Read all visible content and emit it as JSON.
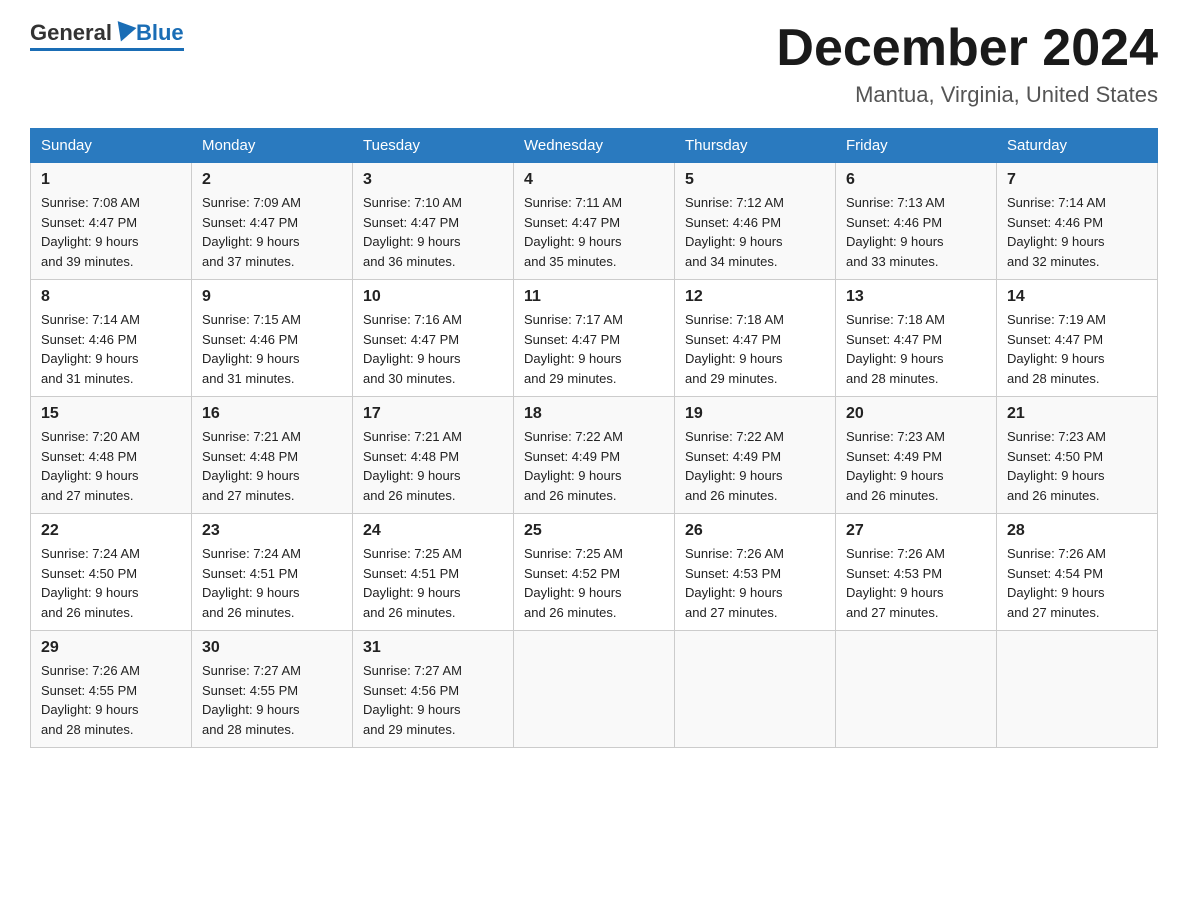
{
  "header": {
    "logo_general": "General",
    "logo_blue": "Blue",
    "month_title": "December 2024",
    "location": "Mantua, Virginia, United States"
  },
  "weekdays": [
    "Sunday",
    "Monday",
    "Tuesday",
    "Wednesday",
    "Thursday",
    "Friday",
    "Saturday"
  ],
  "weeks": [
    [
      {
        "day": "1",
        "sunrise": "7:08 AM",
        "sunset": "4:47 PM",
        "daylight": "9 hours and 39 minutes."
      },
      {
        "day": "2",
        "sunrise": "7:09 AM",
        "sunset": "4:47 PM",
        "daylight": "9 hours and 37 minutes."
      },
      {
        "day": "3",
        "sunrise": "7:10 AM",
        "sunset": "4:47 PM",
        "daylight": "9 hours and 36 minutes."
      },
      {
        "day": "4",
        "sunrise": "7:11 AM",
        "sunset": "4:47 PM",
        "daylight": "9 hours and 35 minutes."
      },
      {
        "day": "5",
        "sunrise": "7:12 AM",
        "sunset": "4:46 PM",
        "daylight": "9 hours and 34 minutes."
      },
      {
        "day": "6",
        "sunrise": "7:13 AM",
        "sunset": "4:46 PM",
        "daylight": "9 hours and 33 minutes."
      },
      {
        "day": "7",
        "sunrise": "7:14 AM",
        "sunset": "4:46 PM",
        "daylight": "9 hours and 32 minutes."
      }
    ],
    [
      {
        "day": "8",
        "sunrise": "7:14 AM",
        "sunset": "4:46 PM",
        "daylight": "9 hours and 31 minutes."
      },
      {
        "day": "9",
        "sunrise": "7:15 AM",
        "sunset": "4:46 PM",
        "daylight": "9 hours and 31 minutes."
      },
      {
        "day": "10",
        "sunrise": "7:16 AM",
        "sunset": "4:47 PM",
        "daylight": "9 hours and 30 minutes."
      },
      {
        "day": "11",
        "sunrise": "7:17 AM",
        "sunset": "4:47 PM",
        "daylight": "9 hours and 29 minutes."
      },
      {
        "day": "12",
        "sunrise": "7:18 AM",
        "sunset": "4:47 PM",
        "daylight": "9 hours and 29 minutes."
      },
      {
        "day": "13",
        "sunrise": "7:18 AM",
        "sunset": "4:47 PM",
        "daylight": "9 hours and 28 minutes."
      },
      {
        "day": "14",
        "sunrise": "7:19 AM",
        "sunset": "4:47 PM",
        "daylight": "9 hours and 28 minutes."
      }
    ],
    [
      {
        "day": "15",
        "sunrise": "7:20 AM",
        "sunset": "4:48 PM",
        "daylight": "9 hours and 27 minutes."
      },
      {
        "day": "16",
        "sunrise": "7:21 AM",
        "sunset": "4:48 PM",
        "daylight": "9 hours and 27 minutes."
      },
      {
        "day": "17",
        "sunrise": "7:21 AM",
        "sunset": "4:48 PM",
        "daylight": "9 hours and 26 minutes."
      },
      {
        "day": "18",
        "sunrise": "7:22 AM",
        "sunset": "4:49 PM",
        "daylight": "9 hours and 26 minutes."
      },
      {
        "day": "19",
        "sunrise": "7:22 AM",
        "sunset": "4:49 PM",
        "daylight": "9 hours and 26 minutes."
      },
      {
        "day": "20",
        "sunrise": "7:23 AM",
        "sunset": "4:49 PM",
        "daylight": "9 hours and 26 minutes."
      },
      {
        "day": "21",
        "sunrise": "7:23 AM",
        "sunset": "4:50 PM",
        "daylight": "9 hours and 26 minutes."
      }
    ],
    [
      {
        "day": "22",
        "sunrise": "7:24 AM",
        "sunset": "4:50 PM",
        "daylight": "9 hours and 26 minutes."
      },
      {
        "day": "23",
        "sunrise": "7:24 AM",
        "sunset": "4:51 PM",
        "daylight": "9 hours and 26 minutes."
      },
      {
        "day": "24",
        "sunrise": "7:25 AM",
        "sunset": "4:51 PM",
        "daylight": "9 hours and 26 minutes."
      },
      {
        "day": "25",
        "sunrise": "7:25 AM",
        "sunset": "4:52 PM",
        "daylight": "9 hours and 26 minutes."
      },
      {
        "day": "26",
        "sunrise": "7:26 AM",
        "sunset": "4:53 PM",
        "daylight": "9 hours and 27 minutes."
      },
      {
        "day": "27",
        "sunrise": "7:26 AM",
        "sunset": "4:53 PM",
        "daylight": "9 hours and 27 minutes."
      },
      {
        "day": "28",
        "sunrise": "7:26 AM",
        "sunset": "4:54 PM",
        "daylight": "9 hours and 27 minutes."
      }
    ],
    [
      {
        "day": "29",
        "sunrise": "7:26 AM",
        "sunset": "4:55 PM",
        "daylight": "9 hours and 28 minutes."
      },
      {
        "day": "30",
        "sunrise": "7:27 AM",
        "sunset": "4:55 PM",
        "daylight": "9 hours and 28 minutes."
      },
      {
        "day": "31",
        "sunrise": "7:27 AM",
        "sunset": "4:56 PM",
        "daylight": "9 hours and 29 minutes."
      },
      null,
      null,
      null,
      null
    ]
  ],
  "labels": {
    "sunrise": "Sunrise:",
    "sunset": "Sunset:",
    "daylight": "Daylight:"
  }
}
